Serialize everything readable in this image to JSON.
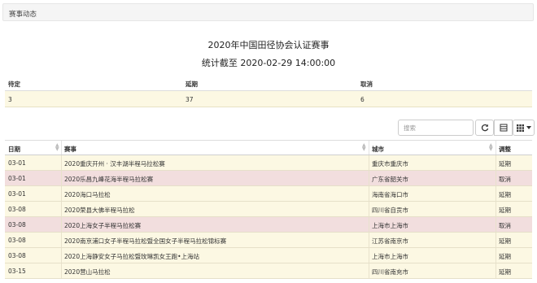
{
  "panel": {
    "title": "赛事动态"
  },
  "report": {
    "title": "2020年中国田径协会认证赛事",
    "stats_time": "统计截至 2020-02-29 14:00:00"
  },
  "summary": {
    "headers": [
      "待定",
      "延期",
      "取消"
    ],
    "values": [
      "3",
      "37",
      "6"
    ]
  },
  "toolbar": {
    "search_placeholder": "搜索"
  },
  "table": {
    "headers": [
      "日期",
      "赛事",
      "城市",
      "调整"
    ],
    "rows": [
      {
        "date": "03-01",
        "name": "2020重庆开州 · 汉丰湖半程马拉松赛",
        "city": "重庆市重庆市",
        "adjust": "延期"
      },
      {
        "date": "03-01",
        "name": "2020乐昌九峰花海半程马拉松赛",
        "city": "广东省韶关市",
        "adjust": "取消"
      },
      {
        "date": "03-01",
        "name": "2020海口马拉松",
        "city": "海南省海口市",
        "adjust": "延期"
      },
      {
        "date": "03-08",
        "name": "2020荣县大佛半程马拉松",
        "city": "四川省自贡市",
        "adjust": "延期"
      },
      {
        "date": "03-08",
        "name": "2020上海女子半程马拉松赛",
        "city": "上海市上海市",
        "adjust": "取消"
      },
      {
        "date": "03-08",
        "name": "2020南京浦口女子半程马拉松暨全国女子半程马拉松锦标赛",
        "city": "江苏省南京市",
        "adjust": "延期"
      },
      {
        "date": "03-08",
        "name": "2020上海静安女子马拉松暨玫琳凯女王跑•上海站",
        "city": "上海市上海市",
        "adjust": "延期"
      },
      {
        "date": "03-15",
        "name": "2020营山马拉松",
        "city": "四川省南充市",
        "adjust": "延期"
      }
    ]
  },
  "colors": {
    "postponed_row": "#fcf8e3",
    "cancelled_row": "#f2dede"
  }
}
